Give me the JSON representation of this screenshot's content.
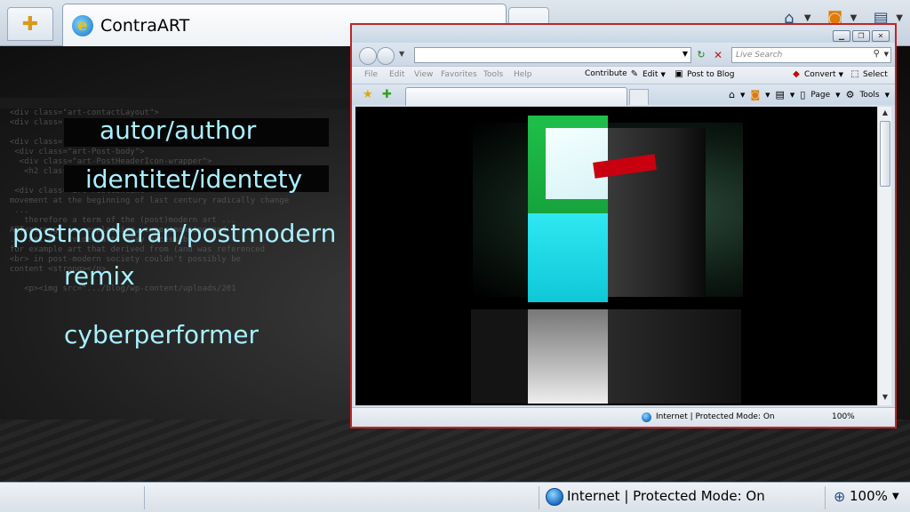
{
  "outer_browser": {
    "tab_title": "ContraART",
    "status_text": "Internet | Protected Mode: On",
    "zoom": "100%"
  },
  "slide_labels": [
    "autor/author",
    "identitet/identety",
    "postmoderan/postmodern",
    "remix",
    "cyberperformer"
  ],
  "inner_browser": {
    "search_placeholder": "Live Search",
    "menu": [
      "File",
      "Edit",
      "View",
      "Favorites",
      "Tools",
      "Help"
    ],
    "toolbar": {
      "contribute": "Contribute",
      "edit": "Edit",
      "post_to_blog": "Post to Blog",
      "convert": "Convert",
      "select": "Select"
    },
    "command_bar": {
      "page": "Page",
      "tools": "Tools"
    },
    "status_text": "Internet | Protected Mode: On",
    "zoom": "100%"
  },
  "colors": {
    "label_text": "#a8f0ff",
    "window_border": "#c32525",
    "video_green": "#1fbf4a",
    "video_cyan": "#11d8e6"
  }
}
